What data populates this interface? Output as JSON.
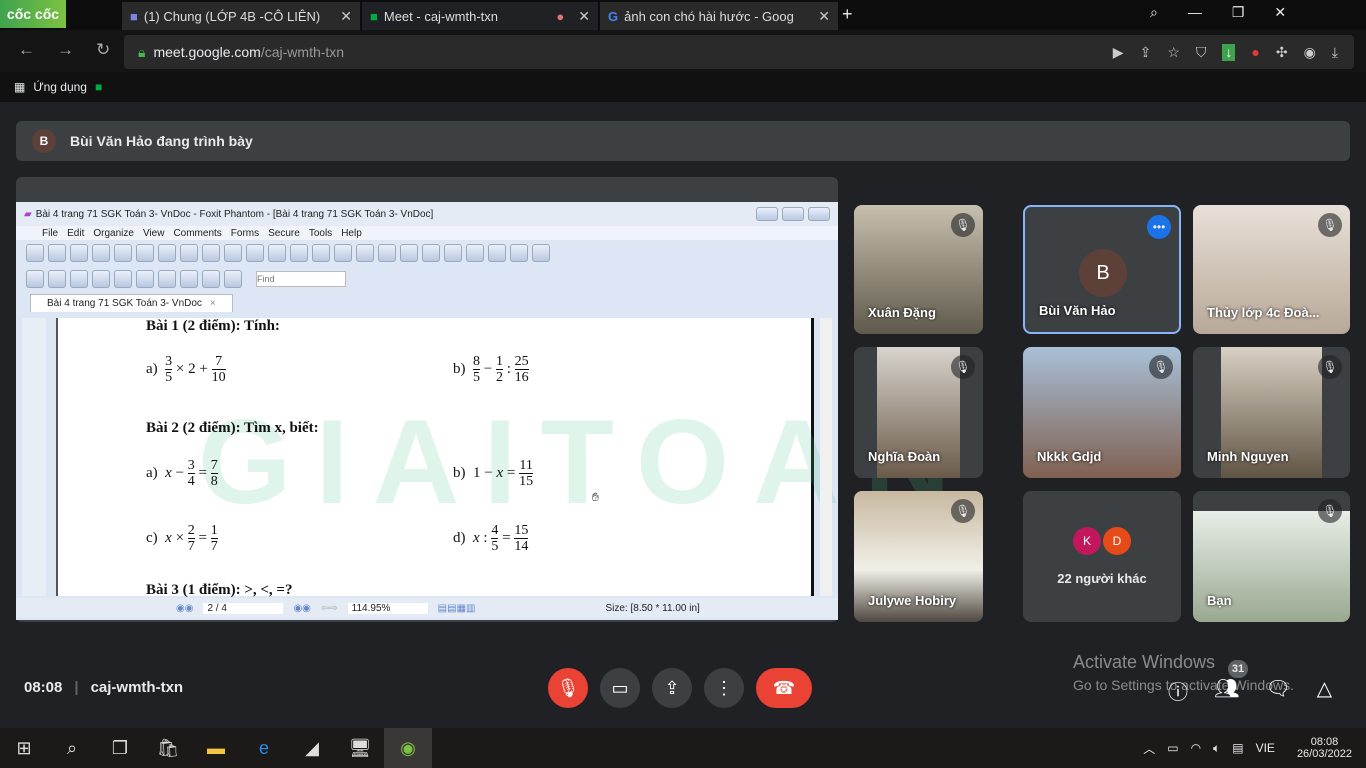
{
  "browser": {
    "brand": "cốc cốc",
    "tabs": [
      {
        "label": "(1) Chung (LỚP 4B -CÔ LIÊN)"
      },
      {
        "label": "Meet - caj-wmth-txn",
        "active": true
      },
      {
        "label": "ảnh con chó hài hước - Goog"
      }
    ],
    "url_host": "meet.google.com",
    "url_path": "/caj-wmth-txn",
    "bookmark": "Ứng dụng"
  },
  "meet": {
    "presenter_initial": "B",
    "banner": "Bùi Văn Hảo đang trình bày",
    "time": "08:08",
    "code": "caj-wmth-txn",
    "participants_count": "31",
    "tiles": [
      {
        "name": "Xuân Đặng"
      },
      {
        "name": "Bùi Văn Hảo",
        "initial": "B"
      },
      {
        "name": "Thủy lớp 4c Đoà..."
      },
      {
        "name": "Nghĩa Đoàn"
      },
      {
        "name": "Nkkk Gdjd"
      },
      {
        "name": "Minh Nguyen"
      },
      {
        "name": "Julywe Hobiry"
      },
      {
        "name": "22 người khác",
        "initials": [
          "K",
          "D"
        ]
      },
      {
        "name": "Bạn"
      }
    ],
    "watermark_title": "Activate Windows",
    "watermark_sub": "Go to Settings to activate Windows."
  },
  "foxit": {
    "title": "Bài 4 trang 71 SGK Toán 3- VnDoc - Foxit Phantom - [Bài 4 trang 71 SGK Toán 3- VnDoc]",
    "menu": [
      "File",
      "Edit",
      "Organize",
      "View",
      "Comments",
      "Forms",
      "Secure",
      "Tools",
      "Help"
    ],
    "find_placeholder": "Find",
    "doc_tab": "Bài 4 trang 71 SGK Toán 3- VnDoc",
    "page": "2 / 4",
    "zoom": "114.95%",
    "size": "Size: [8.50 * 11.00 in]",
    "watermark": "GIAITOAN",
    "content": {
      "bai1": "Bài 1 (2 điểm): Tính:",
      "bai2": "Bài 2 (2 điểm): Tìm x, biết:",
      "bai3": "Bài 3 (1 điểm): >, <, =?"
    }
  },
  "taskbar": {
    "lang": "VIE",
    "time": "08:08",
    "date": "26/03/2022"
  }
}
